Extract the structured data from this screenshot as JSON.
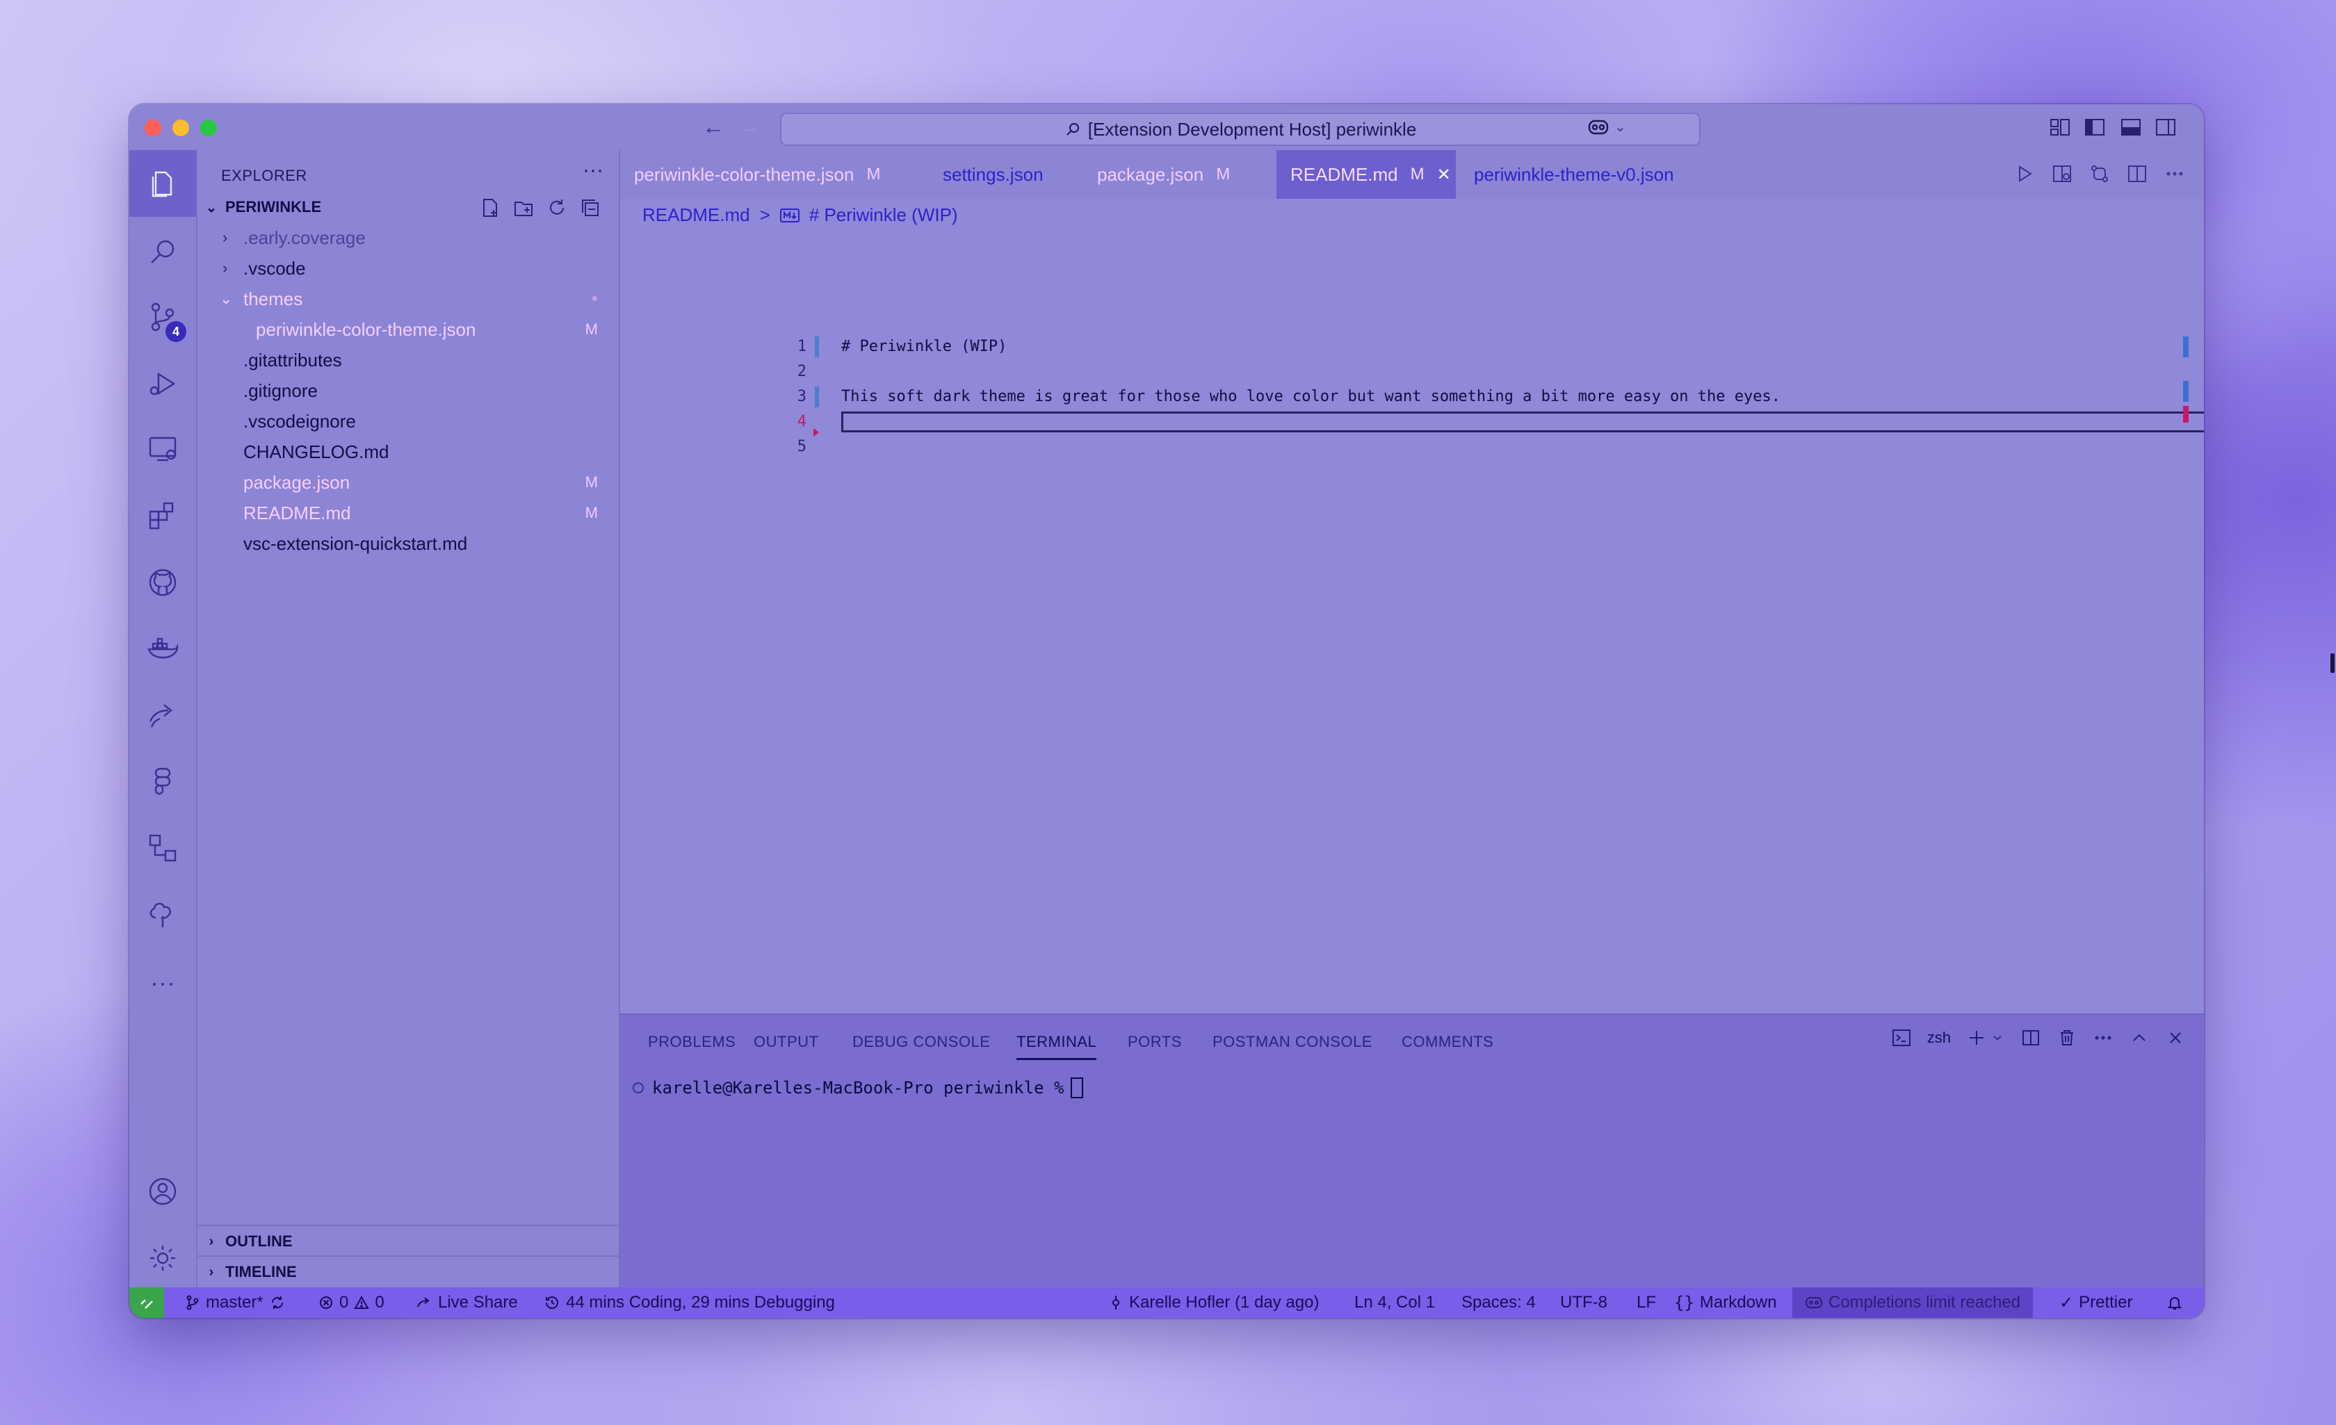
{
  "window": {
    "title": "[Extension Development Host] periwinkle",
    "traffic_colors": [
      "#ff5f57",
      "#febc2e",
      "#28c840"
    ]
  },
  "sidebar": {
    "header": "EXPLORER",
    "more": "···",
    "project": "PERIWINKLE",
    "tree": [
      {
        "label": ".early.coverage",
        "type": "folder",
        "expanded": false,
        "status": ""
      },
      {
        "label": ".vscode",
        "type": "folder",
        "expanded": false,
        "status": ""
      },
      {
        "label": "themes",
        "type": "folder",
        "expanded": true,
        "status": "●"
      },
      {
        "label": "periwinkle-color-theme.json",
        "type": "file",
        "status": "M"
      },
      {
        "label": ".gitattributes",
        "type": "file",
        "status": ""
      },
      {
        "label": ".gitignore",
        "type": "file",
        "status": ""
      },
      {
        "label": ".vscodeignore",
        "type": "file",
        "status": ""
      },
      {
        "label": "CHANGELOG.md",
        "type": "file",
        "status": ""
      },
      {
        "label": "package.json",
        "type": "file",
        "status": "M"
      },
      {
        "label": "README.md",
        "type": "file",
        "status": "M"
      },
      {
        "label": "vsc-extension-quickstart.md",
        "type": "file",
        "status": ""
      }
    ],
    "outline": "OUTLINE",
    "timeline": "TIMELINE"
  },
  "activity": {
    "scm_badge": "4",
    "more": "···"
  },
  "tabs": [
    {
      "label": "periwinkle-color-theme.json",
      "mark": "M"
    },
    {
      "label": "settings.json",
      "mark": ""
    },
    {
      "label": "package.json",
      "mark": "M"
    },
    {
      "label": "README.md",
      "mark": "M",
      "close": "✕"
    },
    {
      "label": "periwinkle-theme-v0.json",
      "mark": ""
    }
  ],
  "breadcrumb": {
    "file": "README.md",
    "separator": ">",
    "symbol": "# Periwinkle (WIP)"
  },
  "editor": {
    "lines": [
      {
        "num": "1",
        "text": "# Periwinkle (WIP)"
      },
      {
        "num": "2",
        "text": ""
      },
      {
        "num": "3",
        "text": "This soft dark theme is great for those who love color but want something a bit more easy on the eyes."
      },
      {
        "num": "4",
        "text": ""
      },
      {
        "num": "5",
        "text": ""
      }
    ]
  },
  "panel": {
    "tabs": [
      "PROBLEMS",
      "OUTPUT",
      "DEBUG CONSOLE",
      "TERMINAL",
      "PORTS",
      "POSTMAN CONSOLE",
      "COMMENTS"
    ],
    "active_tab": "TERMINAL",
    "shell": "zsh",
    "prompt": "karelle@Karelles-MacBook-Pro periwinkle %"
  },
  "statusbar": {
    "branch": "master*",
    "errors": "0",
    "warnings": "0",
    "live_share": "Live Share",
    "timer": "44 mins Coding, 29 mins Debugging",
    "blame": "Karelle Hofler (1 day ago)",
    "position": "Ln 4, Col 1",
    "spaces": "Spaces: 4",
    "encoding": "UTF-8",
    "eol": "LF",
    "language": "Markdown",
    "copilot": "Completions limit reached",
    "formatter": "Prettier"
  }
}
